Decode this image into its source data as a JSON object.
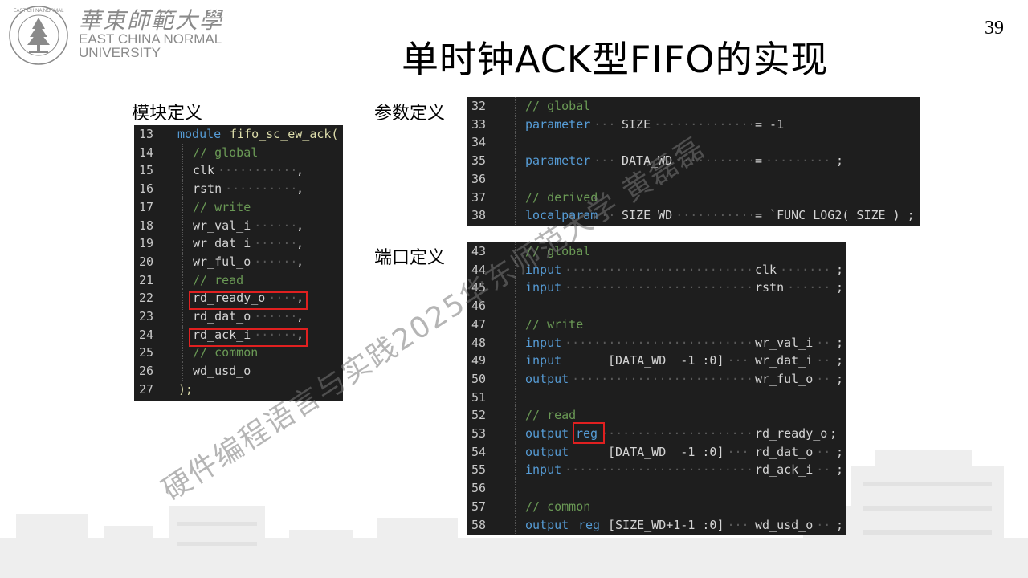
{
  "logo": {
    "cn_name": "華東師範大學",
    "en_line1": "EAST CHINA NORMAL",
    "en_line2": "UNIVERSITY",
    "seal_ring_text": "EAST CHINA NORMAL UNIVERSITY"
  },
  "page_number": "39",
  "title": "单时钟ACK型FIFO的实现",
  "sections": {
    "module_def": "模块定义",
    "param_def": "参数定义",
    "port_def": "端口定义"
  },
  "watermark": "硬件编程语言与实践2025华东师范大学 黄磊磊",
  "colors": {
    "code_bg": "#1e1e1e",
    "keyword": "#569cd6",
    "comment": "#6a9955",
    "highlight": "#e02020"
  },
  "module_code": [
    {
      "ln": "13",
      "toks": [
        {
          "t": "module",
          "c": "kw"
        },
        {
          "t": "fifo_sc_ew_ack(",
          "c": "fn"
        }
      ]
    },
    {
      "ln": "14",
      "toks": [
        {
          "t": "// global",
          "c": "cm"
        }
      ]
    },
    {
      "ln": "15",
      "toks": [
        {
          "t": "clk",
          "c": "id"
        },
        {
          "t": ",",
          "c": "id"
        }
      ]
    },
    {
      "ln": "16",
      "toks": [
        {
          "t": "rstn",
          "c": "id"
        },
        {
          "t": ",",
          "c": "id"
        }
      ]
    },
    {
      "ln": "17",
      "toks": [
        {
          "t": "// write",
          "c": "cm"
        }
      ]
    },
    {
      "ln": "18",
      "toks": [
        {
          "t": "wr_val_i",
          "c": "id"
        },
        {
          "t": ",",
          "c": "id"
        }
      ]
    },
    {
      "ln": "19",
      "toks": [
        {
          "t": "wr_dat_i",
          "c": "id"
        },
        {
          "t": ",",
          "c": "id"
        }
      ]
    },
    {
      "ln": "20",
      "toks": [
        {
          "t": "wr_ful_o",
          "c": "id"
        },
        {
          "t": ",",
          "c": "id"
        }
      ]
    },
    {
      "ln": "21",
      "toks": [
        {
          "t": "// read",
          "c": "cm"
        }
      ]
    },
    {
      "ln": "22",
      "toks": [
        {
          "t": "rd_ready_o",
          "c": "id"
        },
        {
          "t": ",",
          "c": "id"
        }
      ]
    },
    {
      "ln": "23",
      "toks": [
        {
          "t": "rd_dat_o",
          "c": "id"
        },
        {
          "t": ",",
          "c": "id"
        }
      ]
    },
    {
      "ln": "24",
      "toks": [
        {
          "t": "rd_ack_i",
          "c": "id"
        },
        {
          "t": ",",
          "c": "id"
        }
      ]
    },
    {
      "ln": "25",
      "toks": [
        {
          "t": "// common",
          "c": "cm"
        }
      ]
    },
    {
      "ln": "26",
      "toks": [
        {
          "t": "wd_usd_o",
          "c": "id"
        }
      ]
    },
    {
      "ln": "27",
      "toks": [
        {
          "t": ");",
          "c": "fn"
        }
      ]
    }
  ],
  "param_code": [
    {
      "ln": "32",
      "toks": [
        {
          "t": "// global",
          "c": "cm"
        }
      ]
    },
    {
      "ln": "33",
      "toks": [
        {
          "t": "parameter",
          "c": "kw"
        },
        {
          "t": "SIZE",
          "c": "id"
        },
        {
          "t": "= -1",
          "c": "id"
        }
      ]
    },
    {
      "ln": "34",
      "toks": []
    },
    {
      "ln": "35",
      "toks": [
        {
          "t": "parameter",
          "c": "kw"
        },
        {
          "t": "DATA_WD",
          "c": "id"
        },
        {
          "t": "=",
          "c": "id"
        },
        {
          "t": ";",
          "c": "id"
        }
      ]
    },
    {
      "ln": "36",
      "toks": []
    },
    {
      "ln": "37",
      "toks": [
        {
          "t": "// derived",
          "c": "cm"
        }
      ]
    },
    {
      "ln": "38",
      "toks": [
        {
          "t": "localparam",
          "c": "kw"
        },
        {
          "t": "SIZE_WD",
          "c": "id"
        },
        {
          "t": "= `FUNC_LOG2( SIZE ) ;",
          "c": "id"
        }
      ]
    }
  ],
  "port_code": [
    {
      "ln": "43",
      "toks": [
        {
          "t": "// global",
          "c": "cm"
        }
      ]
    },
    {
      "ln": "44",
      "toks": [
        {
          "t": "input",
          "c": "kw"
        },
        {
          "t": "clk",
          "c": "id"
        },
        {
          "t": ";",
          "c": "id"
        }
      ]
    },
    {
      "ln": "45",
      "toks": [
        {
          "t": "input",
          "c": "kw"
        },
        {
          "t": "rstn",
          "c": "id"
        },
        {
          "t": ";",
          "c": "id"
        }
      ]
    },
    {
      "ln": "46",
      "toks": []
    },
    {
      "ln": "47",
      "toks": [
        {
          "t": "// write",
          "c": "cm"
        }
      ]
    },
    {
      "ln": "48",
      "toks": [
        {
          "t": "input",
          "c": "kw"
        },
        {
          "t": "wr_val_i",
          "c": "id"
        },
        {
          "t": ";",
          "c": "id"
        }
      ]
    },
    {
      "ln": "49",
      "toks": [
        {
          "t": "input",
          "c": "kw"
        },
        {
          "t": "[DATA_WD  -1 :0]",
          "c": "id"
        },
        {
          "t": "wr_dat_i",
          "c": "id"
        },
        {
          "t": ";",
          "c": "id"
        }
      ]
    },
    {
      "ln": "50",
      "toks": [
        {
          "t": "output",
          "c": "kw"
        },
        {
          "t": "wr_ful_o",
          "c": "id"
        },
        {
          "t": ";",
          "c": "id"
        }
      ]
    },
    {
      "ln": "51",
      "toks": []
    },
    {
      "ln": "52",
      "toks": [
        {
          "t": "// read",
          "c": "cm"
        }
      ]
    },
    {
      "ln": "53",
      "toks": [
        {
          "t": "output",
          "c": "kw"
        },
        {
          "t": "reg",
          "c": "kw"
        },
        {
          "t": "rd_ready_o",
          "c": "id"
        },
        {
          "t": ";",
          "c": "id"
        }
      ]
    },
    {
      "ln": "54",
      "toks": [
        {
          "t": "output",
          "c": "kw"
        },
        {
          "t": "[DATA_WD  -1 :0]",
          "c": "id"
        },
        {
          "t": "rd_dat_o",
          "c": "id"
        },
        {
          "t": ";",
          "c": "id"
        }
      ]
    },
    {
      "ln": "55",
      "toks": [
        {
          "t": "input",
          "c": "kw"
        },
        {
          "t": "rd_ack_i",
          "c": "id"
        },
        {
          "t": ";",
          "c": "id"
        }
      ]
    },
    {
      "ln": "56",
      "toks": []
    },
    {
      "ln": "57",
      "toks": [
        {
          "t": "// common",
          "c": "cm"
        }
      ]
    },
    {
      "ln": "58",
      "toks": [
        {
          "t": "output",
          "c": "kw"
        },
        {
          "t": "reg",
          "c": "kw"
        },
        {
          "t": "[SIZE_WD+1-1 :0]",
          "c": "id"
        },
        {
          "t": "wd_usd_o",
          "c": "id"
        },
        {
          "t": ";",
          "c": "id"
        }
      ]
    }
  ]
}
